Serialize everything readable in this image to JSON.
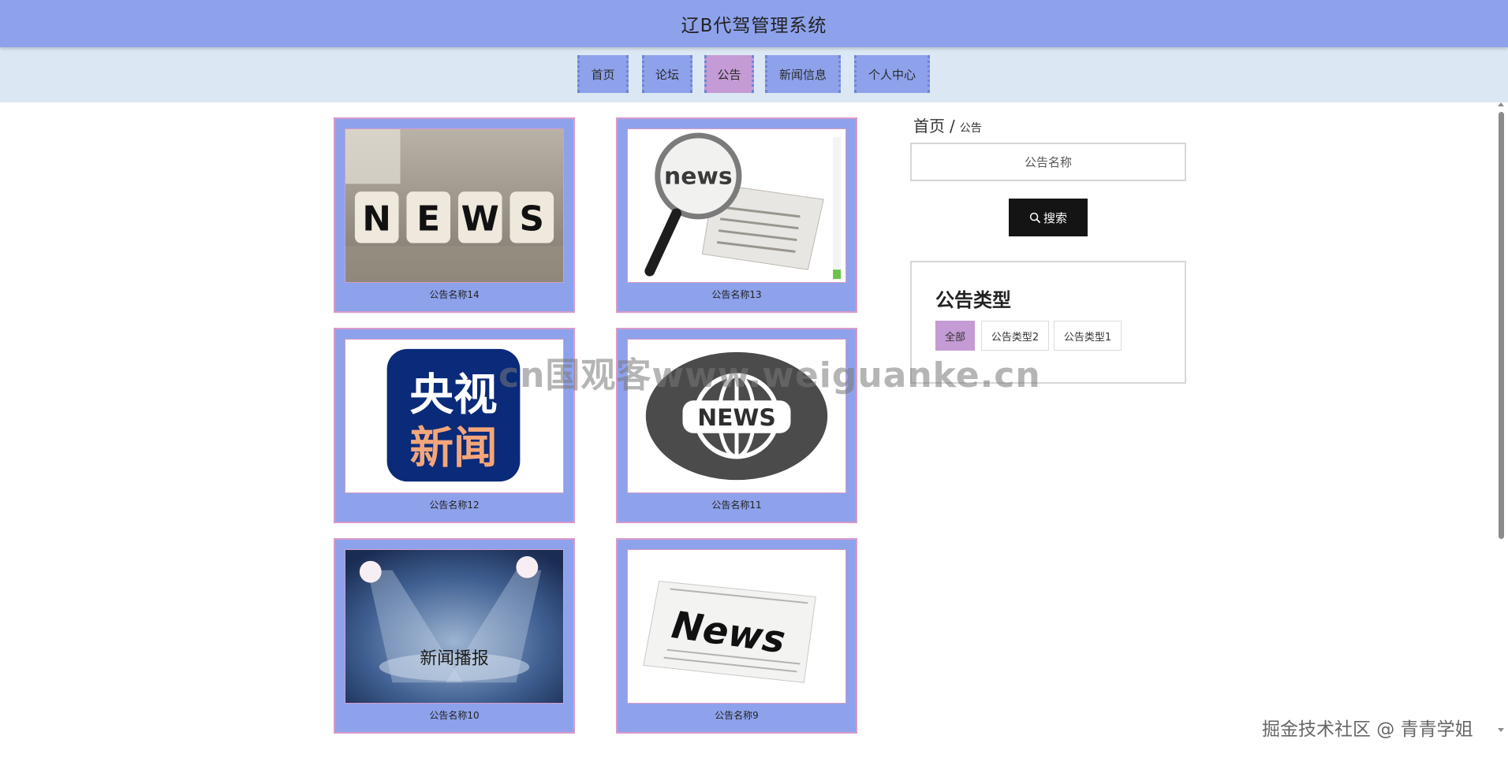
{
  "header": {
    "title": "辽B代驾管理系统"
  },
  "nav": {
    "items": [
      {
        "label": "首页"
      },
      {
        "label": "论坛"
      },
      {
        "label": "公告"
      },
      {
        "label": "新闻信息"
      },
      {
        "label": "个人中心"
      }
    ],
    "active_index": 2
  },
  "breadcrumb": {
    "home": "首页",
    "separator": "/",
    "current": "公告"
  },
  "search": {
    "placeholder": "公告名称",
    "button_label": "搜索",
    "button_icon": "search-icon"
  },
  "categories": {
    "title": "公告类型",
    "items": [
      {
        "label": "全部",
        "active": true
      },
      {
        "label": "公告类型2",
        "active": false
      },
      {
        "label": "公告类型1",
        "active": false
      }
    ]
  },
  "cards": [
    {
      "caption": "公告名称14",
      "image": "news-dice-photo",
      "image_text": "NEWS"
    },
    {
      "caption": "公告名称13",
      "image": "magnifier-newspaper-photo",
      "image_text": "news"
    },
    {
      "caption": "公告名称12",
      "image": "cctv-news-logo",
      "image_text_line1": "央视",
      "image_text_line2": "新闻"
    },
    {
      "caption": "公告名称11",
      "image": "news-globe-logo",
      "image_text": "NEWS"
    },
    {
      "caption": "公告名称10",
      "image": "spotlight-stage-photo",
      "image_text": "新闻播报"
    },
    {
      "caption": "公告名称9",
      "image": "newspaper-photo",
      "image_text": "News"
    }
  ],
  "overlays": {
    "watermark": "cn国观客www.weiguanke.cn",
    "credit": "掘金技术社区 @ 青青学姐"
  },
  "colors": {
    "header_bg": "#8ea2ec",
    "nav_bg": "#dbe8f3",
    "nav_active": "#c49bd4",
    "card_bg": "#8ea2ec",
    "card_border": "#d79bc9",
    "search_button_bg": "#141414"
  }
}
